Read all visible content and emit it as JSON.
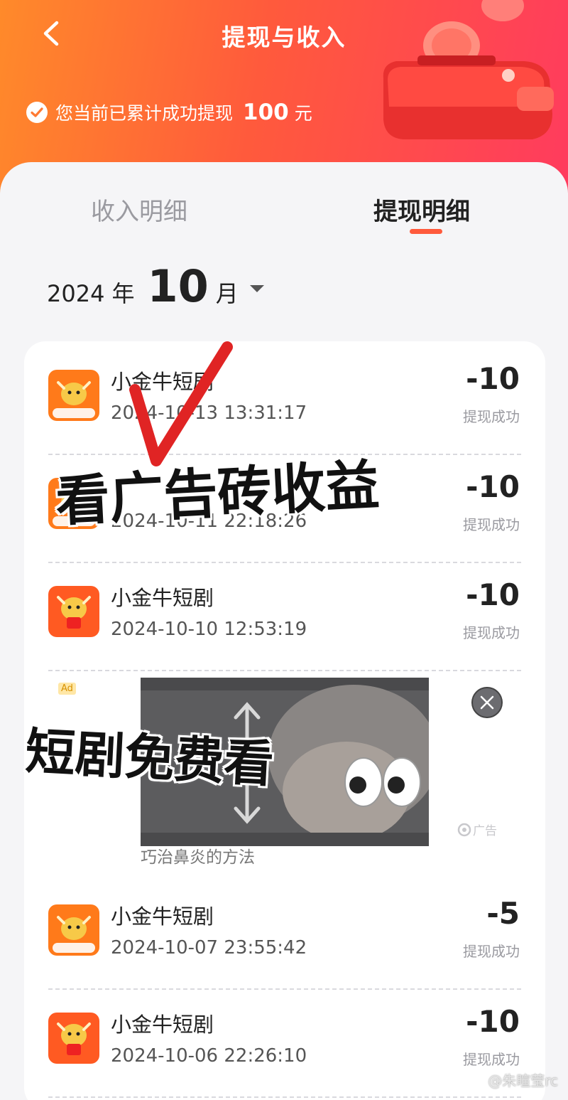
{
  "header": {
    "title": "提现与收入",
    "summary_text": "您当前已累计成功提现",
    "summary_amount": "100",
    "summary_unit": "元"
  },
  "tabs": [
    {
      "label": "收入明细",
      "active": false
    },
    {
      "label": "提现明细",
      "active": true
    }
  ],
  "date_filter": {
    "year": "2024",
    "year_unit": "年",
    "month": "10",
    "month_unit": "月"
  },
  "records": [
    {
      "name": "小金牛短剧",
      "time": "2024-10-13 13:31:17",
      "amount": "-10",
      "status": "提现成功",
      "icon_variant": "一起拿红包"
    },
    {
      "name": "",
      "time": "2024-10-11 22:18:26",
      "amount": "-10",
      "status": "提现成功",
      "icon_variant": "一起拿红包"
    },
    {
      "name": "小金牛短剧",
      "time": "2024-10-10 12:53:19",
      "amount": "-10",
      "status": "提现成功",
      "icon_variant": "送红包啦"
    },
    {
      "name": "小金牛短剧",
      "time": "2024-10-07 23:55:42",
      "amount": "-5",
      "status": "提现成功",
      "icon_variant": "一起拿红包"
    },
    {
      "name": "小金牛短剧",
      "time": "2024-10-06 22:26:10",
      "amount": "-10",
      "status": "提现成功",
      "icon_variant": "送红包啦"
    }
  ],
  "ad": {
    "badge": "Ad",
    "caption": "巧治鼻炎的方法",
    "label": "广告"
  },
  "overlays": {
    "line1": "看广告砖收益",
    "line2": "短剧免费看"
  },
  "watermark": "@朱暄莹rc",
  "colors": {
    "header_start": "#ff8a2a",
    "header_end": "#ff3b5e",
    "accent": "#ff5a3c"
  }
}
